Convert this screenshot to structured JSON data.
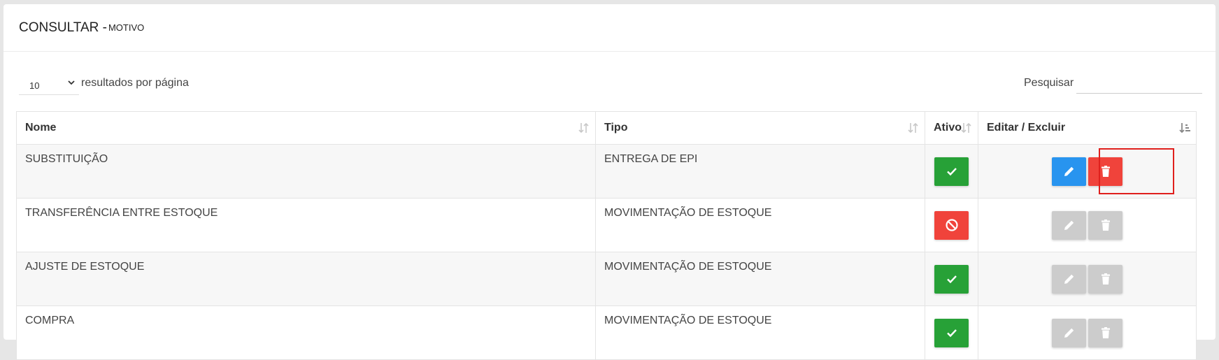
{
  "header": {
    "title": "CONSULTAR - ",
    "subtitle": "MOTIVO"
  },
  "controls": {
    "page_length": "10",
    "page_length_label": "resultados por página",
    "search_label": "Pesquisar",
    "search_value": ""
  },
  "table": {
    "columns": [
      "Nome",
      "Tipo",
      "Ativo",
      "Editar / Excluir"
    ],
    "rows": [
      {
        "nome": "SUBSTITUIÇÃO",
        "tipo": "ENTREGA DE EPI",
        "ativo": true,
        "actions_enabled": true
      },
      {
        "nome": "TRANSFERÊNCIA ENTRE ESTOQUE",
        "tipo": "MOVIMENTAÇÃO DE ESTOQUE",
        "ativo": false,
        "actions_enabled": false
      },
      {
        "nome": "AJUSTE DE ESTOQUE",
        "tipo": "MOVIMENTAÇÃO DE ESTOQUE",
        "ativo": true,
        "actions_enabled": false
      },
      {
        "nome": "COMPRA",
        "tipo": "MOVIMENTAÇÃO DE ESTOQUE",
        "ativo": true,
        "actions_enabled": false
      }
    ]
  },
  "colors": {
    "active": "#27a137",
    "inactive": "#f0433b",
    "edit": "#2894ef",
    "delete": "#f0433b",
    "disabled": "#cccccc",
    "highlight": "#e0201d"
  }
}
